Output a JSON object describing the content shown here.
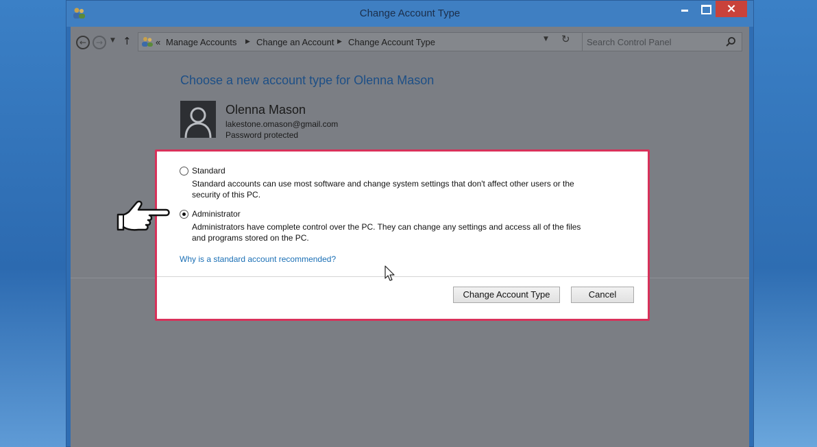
{
  "window": {
    "title": "Change Account Type"
  },
  "address_bar": {
    "breadcrumb": [
      "Manage Accounts",
      "Change an Account",
      "Change Account Type"
    ],
    "overflow": "«"
  },
  "search": {
    "placeholder": "Search Control Panel"
  },
  "page": {
    "heading": "Choose a new account type for Olenna Mason",
    "user": {
      "name": "Olenna Mason",
      "email": "lakestone.omason@gmail.com",
      "status": "Password protected"
    }
  },
  "options": [
    {
      "label": "Standard",
      "description_line1": "Standard accounts can use most software and change system settings that don't affect other users or the",
      "description_line2": "security of this PC.",
      "selected": false
    },
    {
      "label": "Administrator",
      "description_line1": "Administrators have complete control over the PC. They can change any settings and access all of the files",
      "description_line2": "and programs stored on the PC.",
      "selected": true
    }
  ],
  "help_link": "Why is a standard account recommended?",
  "buttons": {
    "change": "Change Account Type",
    "cancel": "Cancel"
  },
  "colors": {
    "highlight_border": "#d8315a",
    "heading": "#1d4f86",
    "link": "#1a6fb5",
    "close_button": "#c9423a"
  }
}
